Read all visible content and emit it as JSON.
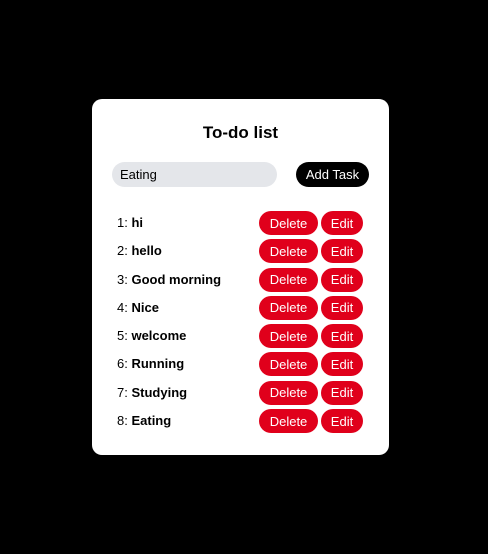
{
  "app": {
    "title": "To-do list"
  },
  "form": {
    "input_value": "Eating",
    "add_label": "Add Task"
  },
  "tasks": [
    {
      "number": "1:",
      "name": "hi"
    },
    {
      "number": "2:",
      "name": "hello"
    },
    {
      "number": "3:",
      "name": "Good morning"
    },
    {
      "number": "4:",
      "name": "Nice"
    },
    {
      "number": "5:",
      "name": "welcome"
    },
    {
      "number": "6:",
      "name": "Running"
    },
    {
      "number": "7:",
      "name": "Studying"
    },
    {
      "number": "8:",
      "name": "Eating"
    }
  ],
  "row_actions": {
    "delete_label": "Delete",
    "edit_label": "Edit"
  },
  "colors": {
    "page_background": "#000000",
    "card_background": "#ffffff",
    "input_background": "#e4e6ea",
    "add_button": "#000000",
    "action_button": "#e0001b"
  }
}
